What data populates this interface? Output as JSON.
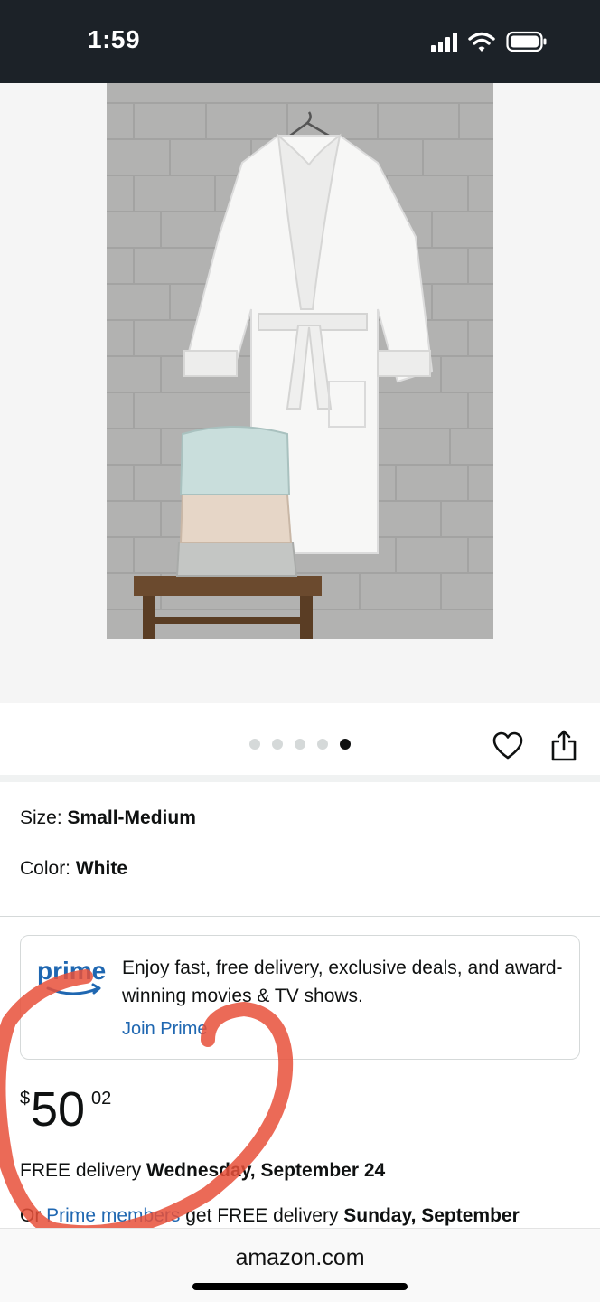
{
  "status_bar": {
    "time": "1:59"
  },
  "gallery": {
    "dot_count": 5,
    "active_index": 4
  },
  "variations": {
    "size_label": "Size: ",
    "size_value": "Small-Medium",
    "color_label": "Color: ",
    "color_value": "White"
  },
  "prime": {
    "logo_text": "prime",
    "message": "Enjoy fast, free delivery, exclusive deals, and award-winning movies & TV shows.",
    "join_label": "Join Prime"
  },
  "price": {
    "symbol": "$",
    "whole": "50",
    "fraction": "02"
  },
  "delivery": {
    "prefix": "FREE delivery ",
    "date": "Wednesday, September 24",
    "prime_prefix": "Or ",
    "prime_link": "Prime members",
    "prime_middle": " get FREE delivery ",
    "prime_date": "Sunday, September"
  },
  "browser": {
    "url": "amazon.com"
  },
  "colors": {
    "status_bar_bg": "#1c2228",
    "link": "#1f67b1",
    "annotation": "#e8503a"
  }
}
